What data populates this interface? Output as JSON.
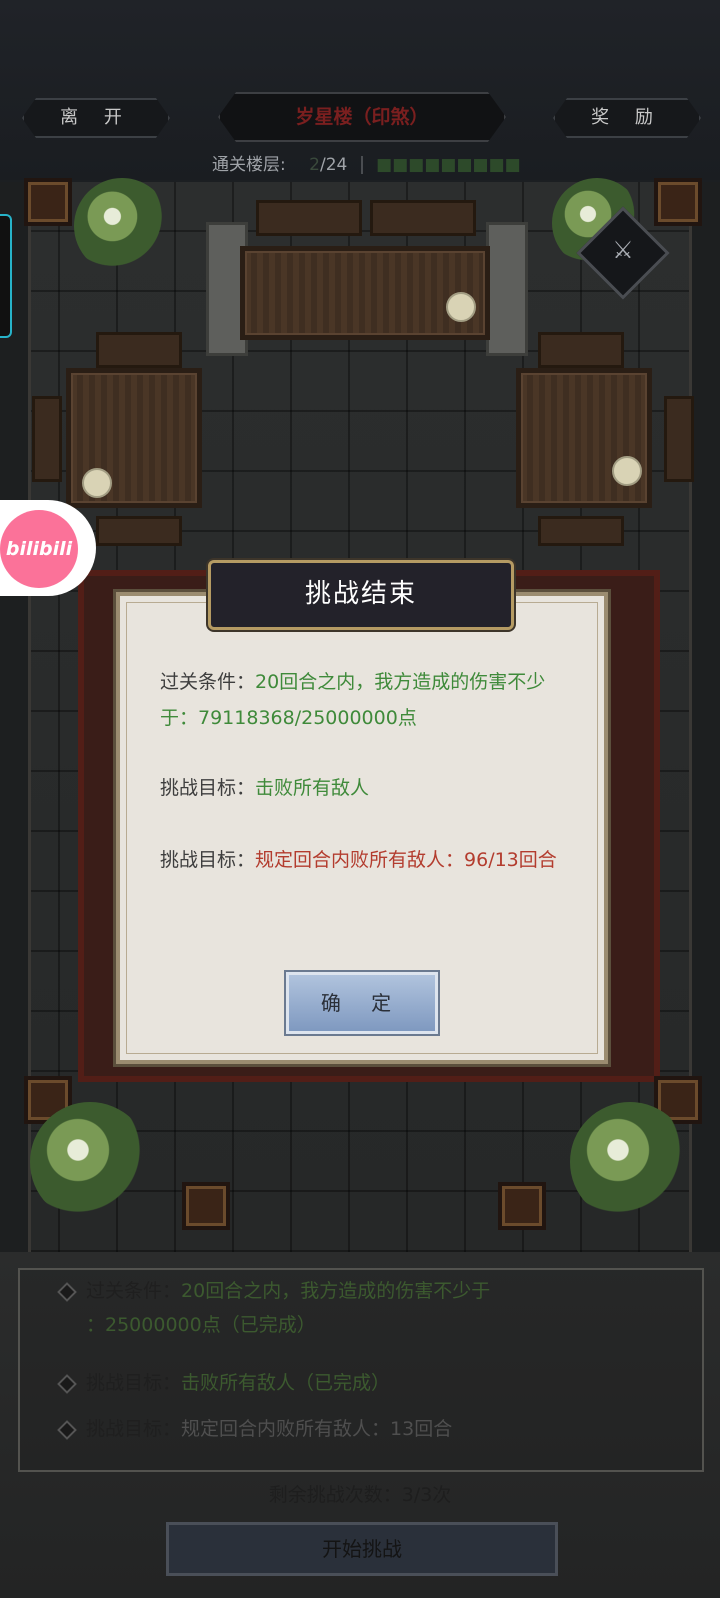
{
  "header": {
    "leave_label": "离 开",
    "title": "岁星楼（印煞）",
    "reward_label": "奖 励",
    "floor_label": "通关楼层:",
    "floor_current": "2",
    "floor_total": "/24"
  },
  "badge": {
    "label": "bilibili"
  },
  "modal": {
    "title": "挑战结束",
    "line1_label": "过关条件：",
    "line1_value": "20回合之内，我方造成的伤害不少于：79118368/25000000点",
    "line2_label": "挑战目标：",
    "line2_value": "击败所有敌人",
    "line3_label": "挑战目标：",
    "line3_value": "规定回合内败所有敌人：96/13回合",
    "confirm_label": "确 定"
  },
  "conditions": {
    "items": [
      {
        "label": "过关条件：",
        "value": "20回合之内，我方造成的伤害不少于",
        "value2": "：25000000点（已完成）"
      },
      {
        "label": "挑战目标：",
        "value": "击败所有敌人（已完成）"
      },
      {
        "label": "挑战目标：",
        "value": "规定回合内败所有敌人：13回合"
      }
    ],
    "remaining": "剩余挑战次数：3/3次",
    "start_label": "开始挑战"
  },
  "colors": {
    "accent_green": "#3f8a3a",
    "accent_red": "#b33c2e",
    "bilibili_pink": "#fb7299"
  }
}
